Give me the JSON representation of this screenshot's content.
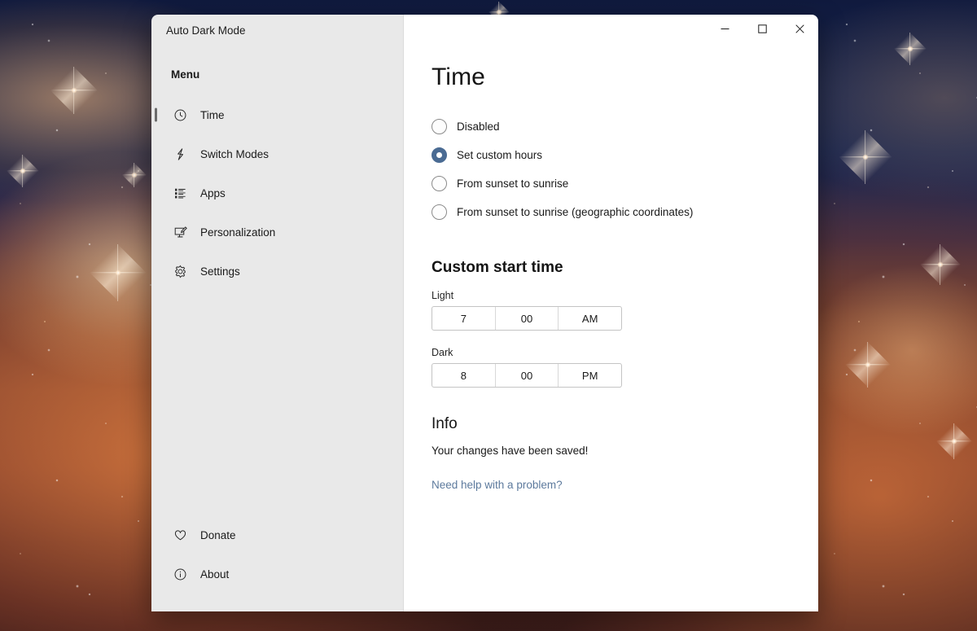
{
  "window": {
    "app_title": "Auto Dark Mode",
    "controls": [
      {
        "name": "minimize",
        "glyph": "minimize-icon"
      },
      {
        "name": "maximize",
        "glyph": "maximize-icon"
      },
      {
        "name": "close",
        "glyph": "close-icon"
      }
    ]
  },
  "sidebar": {
    "heading": "Menu",
    "items": [
      {
        "label": "Time",
        "icon": "clock-icon",
        "selected": true
      },
      {
        "label": "Switch Modes",
        "icon": "lightning-bolt-icon",
        "selected": false
      },
      {
        "label": "Apps",
        "icon": "list-icon",
        "selected": false
      },
      {
        "label": "Personalization",
        "icon": "monitor-pen-icon",
        "selected": false
      },
      {
        "label": "Settings",
        "icon": "gear-icon",
        "selected": false
      }
    ],
    "bottom_items": [
      {
        "label": "Donate",
        "icon": "heart-icon"
      },
      {
        "label": "About",
        "icon": "info-circle-icon"
      }
    ]
  },
  "main": {
    "title": "Time",
    "mode_options": [
      {
        "label": "Disabled",
        "selected": false
      },
      {
        "label": "Set custom hours",
        "selected": true
      },
      {
        "label": "From sunset to sunrise",
        "selected": false
      },
      {
        "label": "From sunset to sunrise (geographic coordinates)",
        "selected": false
      }
    ],
    "custom_time": {
      "heading": "Custom start time",
      "light": {
        "label": "Light",
        "hour": "7",
        "minute": "00",
        "meridiem": "AM"
      },
      "dark": {
        "label": "Dark",
        "hour": "8",
        "minute": "00",
        "meridiem": "PM"
      }
    },
    "info": {
      "heading": "Info",
      "status_text": "Your changes have been saved!",
      "help_link": "Need help with a problem?"
    }
  },
  "colors": {
    "accent_radio": "#4a6b93",
    "link": "#5d7a9d",
    "sidebar_bg": "#e9e9e9",
    "content_bg": "#ffffff",
    "selection_bar": "#6b6b6b"
  }
}
